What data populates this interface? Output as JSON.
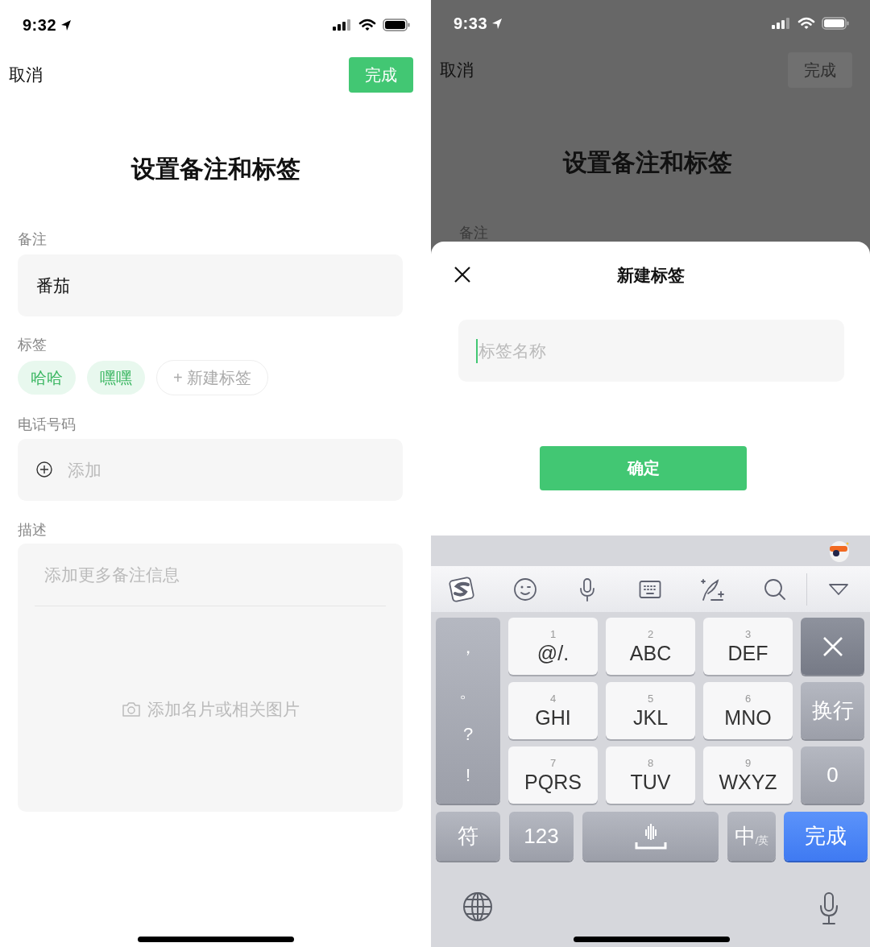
{
  "left_screen": {
    "status_bar": {
      "time": "9:32"
    },
    "nav": {
      "cancel": "取消",
      "done": {
        "label": "完成",
        "enabled": true
      }
    },
    "title": "设置备注和标签",
    "remark": {
      "label": "备注",
      "value": "番茄"
    },
    "tags": {
      "label": "标签",
      "items": [
        {
          "text": "哈哈"
        },
        {
          "text": "嘿嘿"
        }
      ],
      "new_tag": "+ 新建标签"
    },
    "phone": {
      "label": "电话号码",
      "placeholder": "添加"
    },
    "description": {
      "label": "描述",
      "placeholder": "添加更多备注信息",
      "add_image": "添加名片或相关图片"
    }
  },
  "right_screen": {
    "status_bar": {
      "time": "9:33"
    },
    "nav": {
      "cancel": "取消",
      "done": {
        "label": "完成",
        "enabled": false
      }
    },
    "title": "设置备注和标签",
    "remark_label": "备注",
    "sheet": {
      "title": "新建标签",
      "name_field": {
        "placeholder": "标签名称"
      },
      "confirm": "确定"
    },
    "keyboard": {
      "punctuation": [
        "，",
        "。",
        "?",
        "!"
      ],
      "keys": [
        {
          "digit": "1",
          "letters": "@/."
        },
        {
          "digit": "2",
          "letters": "ABC"
        },
        {
          "digit": "3",
          "letters": "DEF"
        },
        {
          "digit": "4",
          "letters": "GHI"
        },
        {
          "digit": "5",
          "letters": "JKL"
        },
        {
          "digit": "6",
          "letters": "MNO"
        },
        {
          "digit": "7",
          "letters": "PQRS"
        },
        {
          "digit": "8",
          "letters": "TUV"
        },
        {
          "digit": "9",
          "letters": "WXYZ"
        }
      ],
      "side_keys": [
        {
          "kind": "delete"
        },
        {
          "kind": "text",
          "label": "换行"
        },
        {
          "kind": "text",
          "label": "0"
        }
      ],
      "bottom_keys": [
        {
          "kind": "text",
          "label": "符"
        },
        {
          "kind": "text",
          "label": "123"
        },
        {
          "kind": "space"
        },
        {
          "kind": "lang",
          "label": "中",
          "sub": "/英"
        },
        {
          "kind": "primary",
          "label": "完成"
        }
      ]
    }
  }
}
